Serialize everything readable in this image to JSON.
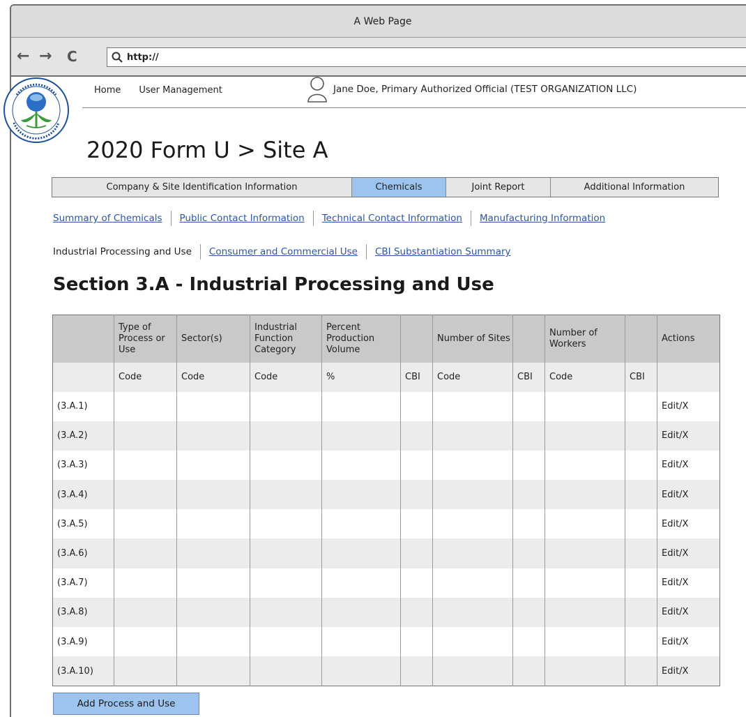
{
  "window": {
    "title": "A Web Page"
  },
  "browser": {
    "url": "http://"
  },
  "topnav": {
    "home": "Home",
    "user_management": "User Management",
    "user": "Jane Doe, Primary Authorized Official (TEST ORGANIZATION LLC)"
  },
  "page_title": "2020 Form U > Site A",
  "tabs": [
    {
      "label": "Company & Site Identification Information",
      "active": false
    },
    {
      "label": "Chemicals",
      "active": true
    },
    {
      "label": "Joint Report",
      "active": false
    },
    {
      "label": "Additional Information",
      "active": false
    }
  ],
  "sublinks_row1": [
    "Summary of Chemicals",
    "Public Contact Information",
    "Technical Contact Information",
    "Manufacturing Information"
  ],
  "sublinks_row2": {
    "current": "Industrial Processing and Use",
    "links": [
      "Consumer and Commercial Use",
      "CBI Substantiation Summary"
    ]
  },
  "section_title": "Section 3.A - Industrial Processing and Use",
  "table": {
    "headers": [
      "",
      "Type of Process or Use",
      "Sector(s)",
      "Industrial Function Category",
      "Percent Production Volume",
      "",
      "Number of Sites",
      "",
      "Number of Workers",
      "",
      "Actions"
    ],
    "subheaders": [
      "",
      "Code",
      "Code",
      "Code",
      "%",
      "CBI",
      "Code",
      "CBI",
      "Code",
      "CBI",
      ""
    ],
    "rows": [
      "(3.A.1)",
      "(3.A.2)",
      "(3.A.3)",
      "(3.A.4)",
      "(3.A.5)",
      "(3.A.6)",
      "(3.A.7)",
      "(3.A.8)",
      "(3.A.9)",
      "(3.A.10)"
    ],
    "action_label": "Edit/X"
  },
  "add_button": "Add Process and Use",
  "colors": {
    "active_tab": "#9cc4ef",
    "link": "#2857a6",
    "header_bg": "#c9c9c9"
  },
  "icons": [
    "back-arrow-icon",
    "forward-arrow-icon",
    "refresh-icon",
    "search-icon",
    "menu-icon",
    "user-icon",
    "epa-seal-logo"
  ]
}
